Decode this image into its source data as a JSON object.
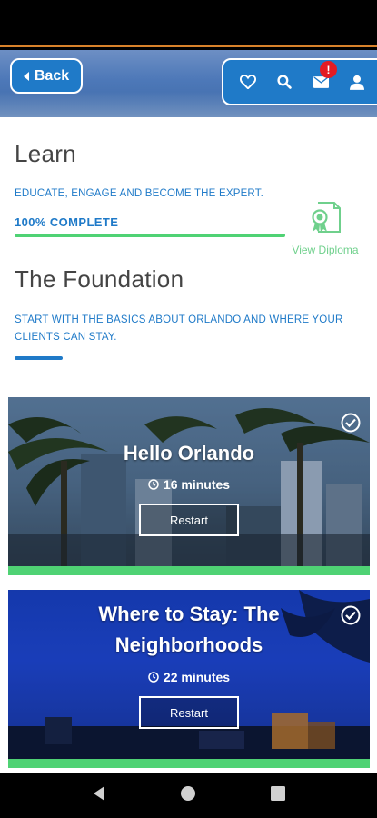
{
  "header": {
    "back_label": "Back",
    "notification_badge": "!",
    "icons": [
      "heart-icon",
      "search-icon",
      "mail-icon",
      "user-icon"
    ]
  },
  "learn": {
    "title": "Learn",
    "subtitle": "EDUCATE, ENGAGE AND BECOME THE EXPERT.",
    "progress_label": "100% COMPLETE",
    "progress_fraction": 1.0,
    "diploma_label": "View Diploma"
  },
  "section": {
    "title": "The Foundation",
    "subtitle": "START WITH THE BASICS ABOUT ORLANDO AND WHERE YOUR CLIENTS CAN STAY."
  },
  "lessons": [
    {
      "title": "Hello Orlando",
      "duration": "16 minutes",
      "button": "Restart",
      "completed": true
    },
    {
      "title": "Where to Stay: The Neighborhoods",
      "duration": "22 minutes",
      "button": "Restart",
      "completed": true
    }
  ],
  "colors": {
    "brand_blue": "#1f7ac8",
    "complete_green": "#4fd274",
    "badge_red": "#e31b23"
  }
}
